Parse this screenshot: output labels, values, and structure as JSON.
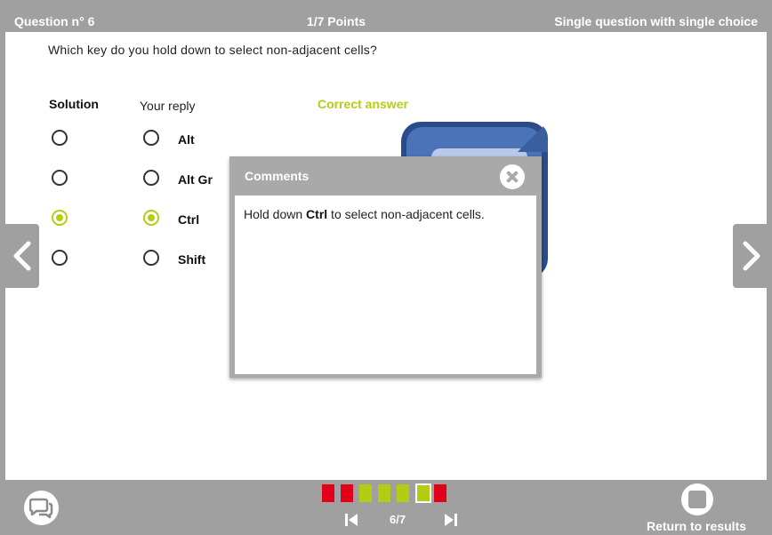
{
  "header": {
    "question_no": "Question n° 6",
    "points": "1/7 Points",
    "question_type": "Single question with single choice"
  },
  "question": {
    "text": "Which key do you hold down to select non-adjacent cells?"
  },
  "columns": {
    "solution": "Solution",
    "reply": "Your reply",
    "correct": "Correct answer"
  },
  "options": [
    {
      "label": "Alt",
      "solution": false,
      "reply": false
    },
    {
      "label": "Alt Gr",
      "solution": false,
      "reply": false
    },
    {
      "label": "Ctrl",
      "solution": true,
      "reply": true
    },
    {
      "label": "Shift",
      "solution": false,
      "reply": false
    }
  ],
  "comments": {
    "title": "Comments",
    "text_before": "Hold down ",
    "text_bold": "Ctrl",
    "text_after": " to select non-adjacent cells."
  },
  "progress": {
    "states": [
      "red",
      "red",
      "green",
      "green",
      "green",
      "green",
      "red"
    ],
    "current_index": 5,
    "page_label": "6/7"
  },
  "footer": {
    "return_label": "Return to results"
  },
  "colors": {
    "correct": "#b5cc14",
    "wrong": "#e2001a",
    "chrome": "#a0a0a0"
  },
  "icons": {
    "prev": "chevron-left-icon",
    "next": "chevron-right-icon",
    "chat": "comments-icon",
    "close": "close-icon",
    "first": "skip-first-icon",
    "last": "skip-last-icon",
    "results": "stop-icon"
  }
}
